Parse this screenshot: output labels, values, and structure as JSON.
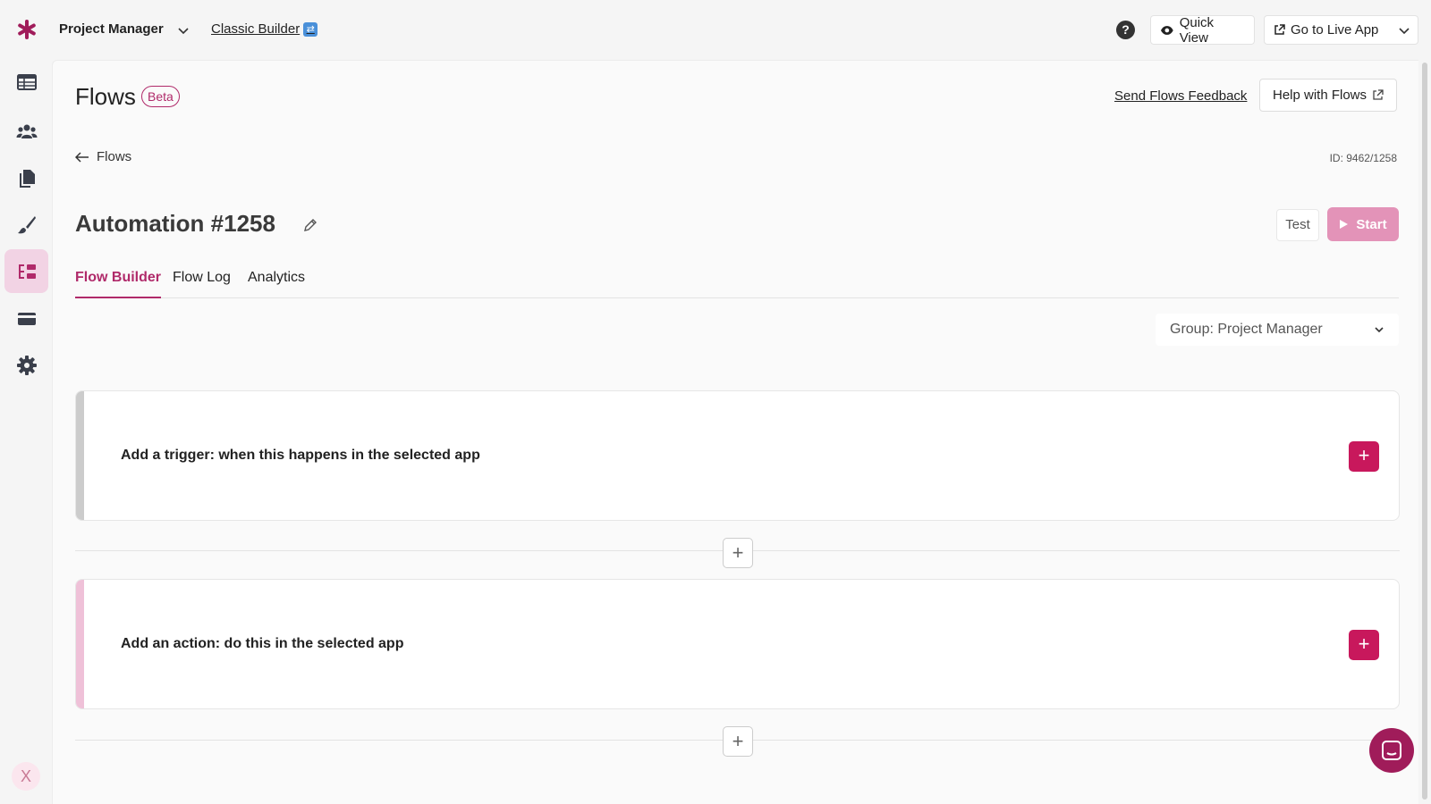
{
  "header": {
    "app_name": "Project Manager",
    "classic_builder": "Classic Builder",
    "quick_view": "Quick View",
    "go_to_live_app": "Go to Live App",
    "help_glyph": "?"
  },
  "sidebar": {
    "items": [
      {
        "icon": "table-icon"
      },
      {
        "icon": "users-icon"
      },
      {
        "icon": "pages-icon"
      },
      {
        "icon": "brush-icon"
      },
      {
        "icon": "flows-icon",
        "active": true
      },
      {
        "icon": "card-icon"
      },
      {
        "icon": "gear-icon"
      }
    ],
    "bottom_badge": "X"
  },
  "page": {
    "title": "Flows",
    "badge": "Beta",
    "send_feedback": "Send Flows Feedback",
    "help_with_flows": "Help with Flows",
    "back_label": "Flows",
    "id_label": "ID: 9462/1258",
    "automation_title": "Automation #1258",
    "test_label": "Test",
    "start_label": "Start"
  },
  "tabs": [
    {
      "label": "Flow Builder",
      "active": true
    },
    {
      "label": "Flow Log",
      "active": false
    },
    {
      "label": "Analytics",
      "active": false
    }
  ],
  "group_select": {
    "value": "Group: Project Manager"
  },
  "cards": [
    {
      "label": "Add a trigger: when this happens in the selected app",
      "stripe_color": "#cccccc"
    },
    {
      "label": "Add an action: do this in the selected app",
      "stripe_color": "#efc1d8"
    }
  ],
  "colors": {
    "brand": "#c8185c",
    "accent_text": "#b02a6a",
    "start_disabled": "#e393b8"
  }
}
